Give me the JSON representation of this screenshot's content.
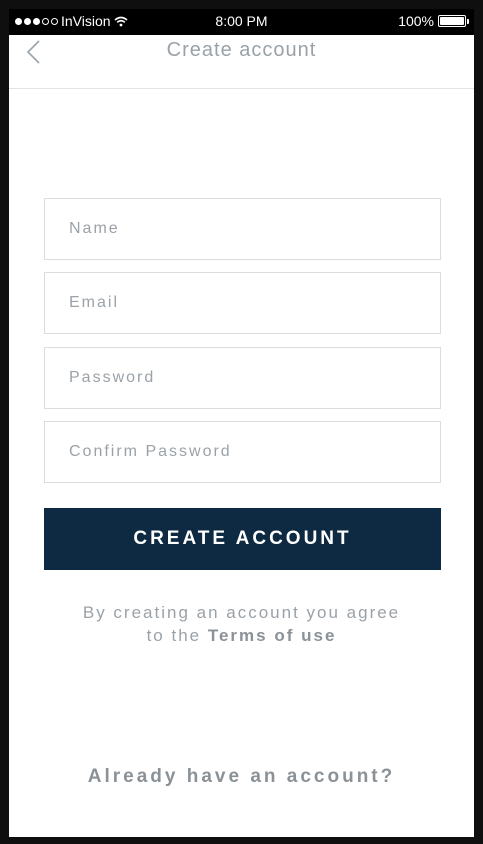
{
  "status_bar": {
    "carrier": "InVision",
    "time": "8:00 PM",
    "battery": "100%"
  },
  "nav": {
    "title": "Create account",
    "back_icon": "chevron-left-icon"
  },
  "form": {
    "name_placeholder": "Name",
    "email_placeholder": "Email",
    "password_placeholder": "Password",
    "confirm_password_placeholder": "Confirm Password",
    "submit_label": "CREATE ACCOUNT"
  },
  "terms": {
    "line1": "By creating an account you agree",
    "prefix": "to the",
    "link": "Terms of use"
  },
  "footer": {
    "signin_link": "Already have an account?"
  },
  "colors": {
    "primary": "#0d2a42",
    "muted_text": "#9aa2a8",
    "border": "#dcdcdc"
  }
}
